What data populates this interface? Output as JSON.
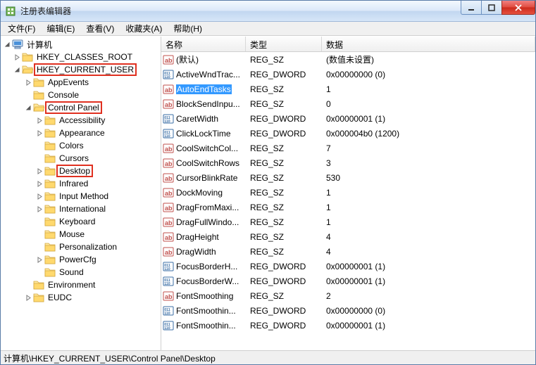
{
  "window": {
    "title": "注册表编辑器"
  },
  "menu": [
    {
      "label": "文件(F)"
    },
    {
      "label": "编辑(E)"
    },
    {
      "label": "查看(V)"
    },
    {
      "label": "收藏夹(A)"
    },
    {
      "label": "帮助(H)"
    }
  ],
  "tree": {
    "root": {
      "label": "计算机"
    },
    "hkcr": {
      "label": "HKEY_CLASSES_ROOT"
    },
    "hkcu": {
      "label": "HKEY_CURRENT_USER"
    },
    "appevents": {
      "label": "AppEvents"
    },
    "console": {
      "label": "Console"
    },
    "cpanel": {
      "label": "Control Panel"
    },
    "accessibility": {
      "label": "Accessibility"
    },
    "appearance": {
      "label": "Appearance"
    },
    "colors": {
      "label": "Colors"
    },
    "cursors": {
      "label": "Cursors"
    },
    "desktop": {
      "label": "Desktop"
    },
    "infrared": {
      "label": "Infrared"
    },
    "inputmethod": {
      "label": "Input Method"
    },
    "international": {
      "label": "International"
    },
    "keyboard": {
      "label": "Keyboard"
    },
    "mouse": {
      "label": "Mouse"
    },
    "personalization": {
      "label": "Personalization"
    },
    "powercfg": {
      "label": "PowerCfg"
    },
    "sound": {
      "label": "Sound"
    },
    "environment": {
      "label": "Environment"
    },
    "eudc": {
      "label": "EUDC"
    }
  },
  "columns": {
    "name": "名称",
    "type": "类型",
    "data": "数据"
  },
  "values": [
    {
      "name": "(默认)",
      "type": "REG_SZ",
      "data": "(数值未设置)",
      "kind": "sz",
      "selected": false
    },
    {
      "name": "ActiveWndTrac...",
      "type": "REG_DWORD",
      "data": "0x00000000 (0)",
      "kind": "dw",
      "selected": false
    },
    {
      "name": "AutoEndTasks",
      "type": "REG_SZ",
      "data": "1",
      "kind": "sz",
      "selected": true
    },
    {
      "name": "BlockSendInpu...",
      "type": "REG_SZ",
      "data": "0",
      "kind": "sz",
      "selected": false
    },
    {
      "name": "CaretWidth",
      "type": "REG_DWORD",
      "data": "0x00000001 (1)",
      "kind": "dw",
      "selected": false
    },
    {
      "name": "ClickLockTime",
      "type": "REG_DWORD",
      "data": "0x000004b0 (1200)",
      "kind": "dw",
      "selected": false
    },
    {
      "name": "CoolSwitchCol...",
      "type": "REG_SZ",
      "data": "7",
      "kind": "sz",
      "selected": false
    },
    {
      "name": "CoolSwitchRows",
      "type": "REG_SZ",
      "data": "3",
      "kind": "sz",
      "selected": false
    },
    {
      "name": "CursorBlinkRate",
      "type": "REG_SZ",
      "data": "530",
      "kind": "sz",
      "selected": false
    },
    {
      "name": "DockMoving",
      "type": "REG_SZ",
      "data": "1",
      "kind": "sz",
      "selected": false
    },
    {
      "name": "DragFromMaxi...",
      "type": "REG_SZ",
      "data": "1",
      "kind": "sz",
      "selected": false
    },
    {
      "name": "DragFullWindo...",
      "type": "REG_SZ",
      "data": "1",
      "kind": "sz",
      "selected": false
    },
    {
      "name": "DragHeight",
      "type": "REG_SZ",
      "data": "4",
      "kind": "sz",
      "selected": false
    },
    {
      "name": "DragWidth",
      "type": "REG_SZ",
      "data": "4",
      "kind": "sz",
      "selected": false
    },
    {
      "name": "FocusBorderH...",
      "type": "REG_DWORD",
      "data": "0x00000001 (1)",
      "kind": "dw",
      "selected": false
    },
    {
      "name": "FocusBorderW...",
      "type": "REG_DWORD",
      "data": "0x00000001 (1)",
      "kind": "dw",
      "selected": false
    },
    {
      "name": "FontSmoothing",
      "type": "REG_SZ",
      "data": "2",
      "kind": "sz",
      "selected": false
    },
    {
      "name": "FontSmoothin...",
      "type": "REG_DWORD",
      "data": "0x00000000 (0)",
      "kind": "dw",
      "selected": false
    },
    {
      "name": "FontSmoothin...",
      "type": "REG_DWORD",
      "data": "0x00000001 (1)",
      "kind": "dw",
      "selected": false
    }
  ],
  "statusbar": {
    "path": "计算机\\HKEY_CURRENT_USER\\Control Panel\\Desktop"
  }
}
